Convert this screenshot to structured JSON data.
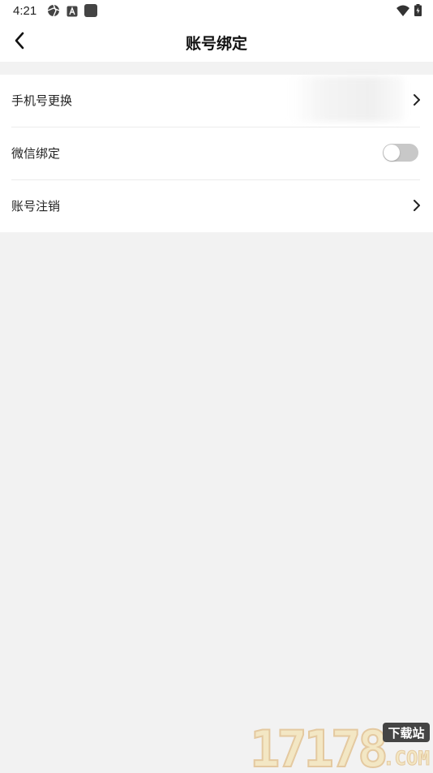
{
  "status_bar": {
    "time": "4:21",
    "left_icons": [
      "aperture-icon",
      "a-square-icon",
      "app-square-icon"
    ],
    "right_icons": [
      "wifi-icon",
      "battery-charging-icon"
    ]
  },
  "nav": {
    "title": "账号绑定",
    "back_icon": "chevron-left-icon"
  },
  "settings": {
    "rows": [
      {
        "label": "手机号更换",
        "value_blurred": true,
        "trailing": "chevron-right-icon"
      },
      {
        "label": "微信绑定",
        "toggle_on": false
      },
      {
        "label": "账号注销",
        "trailing": "chevron-right-icon"
      }
    ]
  },
  "watermark": {
    "number": "17178",
    "tag": "下载站",
    "domain": ".COM"
  },
  "colors": {
    "background": "#f2f2f2",
    "card": "#ffffff",
    "toggle_off": "#c8c8c8",
    "divider": "#ececec"
  }
}
